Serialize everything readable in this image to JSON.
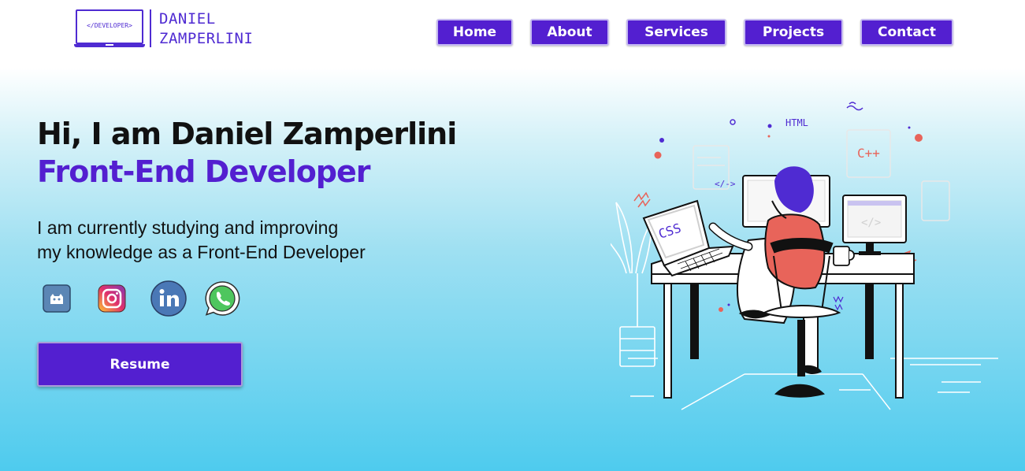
{
  "header": {
    "logo": {
      "screen_text": "</DEVELOPER>",
      "name_line1": "DANIEL",
      "name_line2": "ZAMPERLINI"
    },
    "nav": [
      {
        "label": "Home"
      },
      {
        "label": "About"
      },
      {
        "label": "Services"
      },
      {
        "label": "Projects"
      },
      {
        "label": "Contact"
      }
    ]
  },
  "hero": {
    "greeting": "Hi, I am Daniel Zamperlini",
    "role": "Front-End Developer",
    "description_line1": "I am currently studying and improving",
    "description_line2": "my knowledge as a Front-End Developer",
    "social": [
      {
        "icon": "github-icon"
      },
      {
        "icon": "instagram-icon"
      },
      {
        "icon": "linkedin-icon"
      },
      {
        "icon": "whatsapp-icon"
      }
    ],
    "resume_label": "Resume",
    "illustration": {
      "css_label": "CSS",
      "html_label": "HTML",
      "cpp_label": "C++",
      "code_tag": "</->"
    }
  },
  "colors": {
    "accent": "#531fd0",
    "hero_bottom": "#4ecbee",
    "text": "#111111"
  }
}
